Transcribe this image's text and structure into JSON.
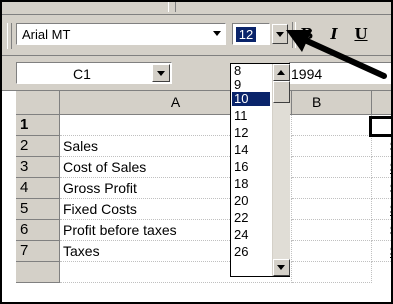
{
  "toolbar": {
    "font_name": "Arial MT",
    "font_size": "12",
    "bold_label": "B",
    "italic_label": "I",
    "underline_label": "U"
  },
  "formula_bar": {
    "name_box": "C1",
    "content": "1994"
  },
  "grid": {
    "columns": [
      "A",
      "B"
    ],
    "rows": [
      {
        "num": "1",
        "a": "",
        "c": ""
      },
      {
        "num": "2",
        "a": "Sales",
        "c": "$"
      },
      {
        "num": "3",
        "a": "Cost of Sales",
        "c": "$"
      },
      {
        "num": "4",
        "a": "Gross Profit",
        "c": "$"
      },
      {
        "num": "5",
        "a": "Fixed Costs",
        "c": "$"
      },
      {
        "num": "6",
        "a": "Profit before taxes",
        "c": "$"
      },
      {
        "num": "7",
        "a": "Taxes",
        "c": "$"
      }
    ]
  },
  "size_list": {
    "items": [
      "8",
      "9",
      "10",
      "11",
      "12",
      "14",
      "16",
      "18",
      "20",
      "22",
      "24",
      "26"
    ],
    "highlighted": "10"
  },
  "colors": {
    "chrome": "#d4d0c8",
    "selection": "#0a246a"
  }
}
